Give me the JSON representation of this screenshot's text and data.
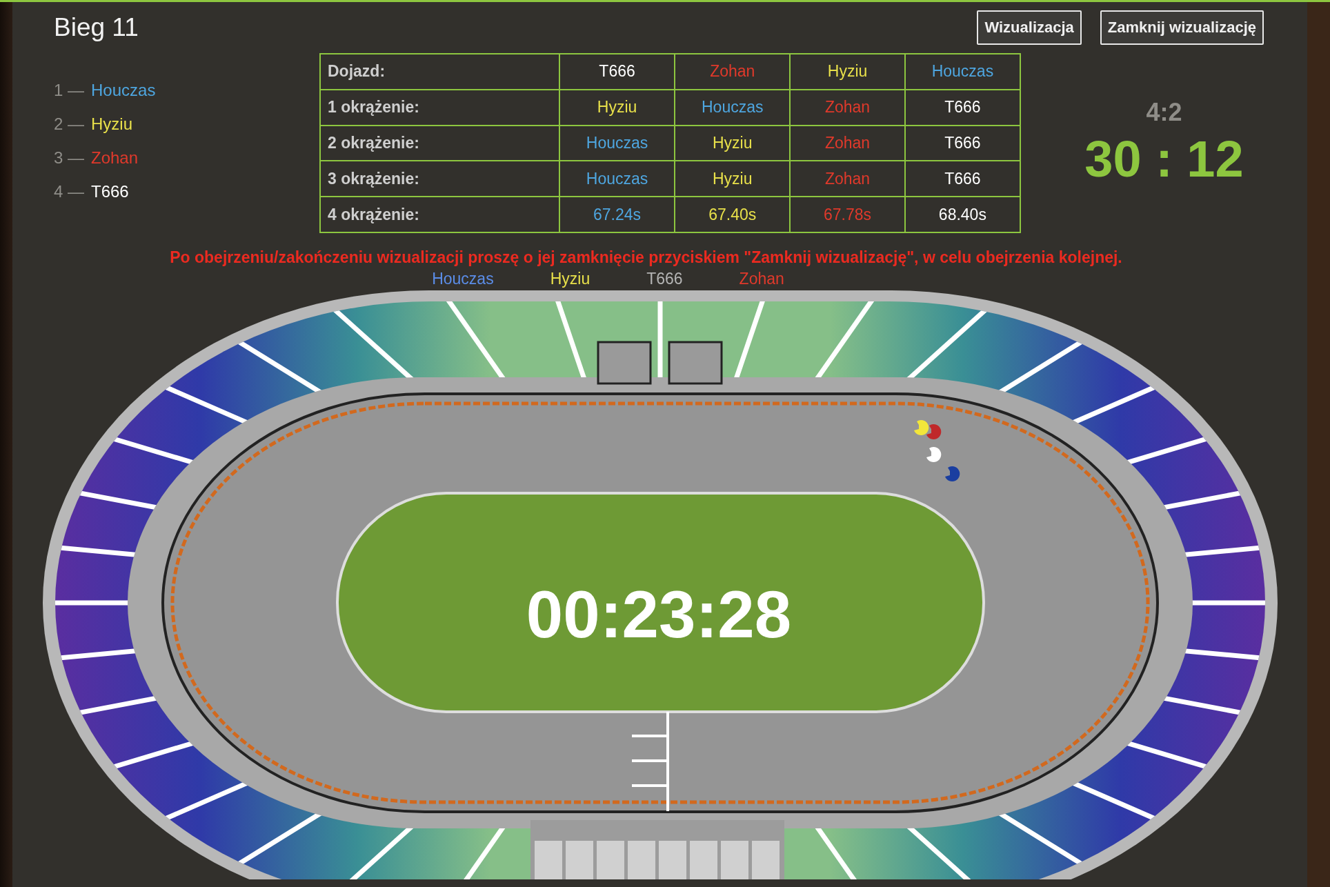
{
  "title": "Bieg 11",
  "buttons": [
    {
      "label": "Wizualizacja"
    },
    {
      "label": "Zamknij wizualizację"
    }
  ],
  "standings": [
    {
      "place": "1 —",
      "name": "Houczas",
      "color": "#4ea6e0"
    },
    {
      "place": "2 —",
      "name": "Hyziu",
      "color": "#e8e04a"
    },
    {
      "place": "3 —",
      "name": "Zohan",
      "color": "#e0392b"
    },
    {
      "place": "4 —",
      "name": "T666",
      "color": "#ffffff"
    }
  ],
  "table": {
    "rows": [
      {
        "label": "Dojazd:",
        "cells": [
          {
            "text": "T666",
            "color": "#ffffff"
          },
          {
            "text": "Zohan",
            "color": "#e0392b"
          },
          {
            "text": "Hyziu",
            "color": "#e8e04a"
          },
          {
            "text": "Houczas",
            "color": "#4ea6e0"
          }
        ]
      },
      {
        "label": "1 okrążenie:",
        "cells": [
          {
            "text": "Hyziu",
            "color": "#e8e04a"
          },
          {
            "text": "Houczas",
            "color": "#4ea6e0"
          },
          {
            "text": "Zohan",
            "color": "#e0392b"
          },
          {
            "text": "T666",
            "color": "#ffffff"
          }
        ]
      },
      {
        "label": "2 okrążenie:",
        "cells": [
          {
            "text": "Houczas",
            "color": "#4ea6e0"
          },
          {
            "text": "Hyziu",
            "color": "#e8e04a"
          },
          {
            "text": "Zohan",
            "color": "#e0392b"
          },
          {
            "text": "T666",
            "color": "#ffffff"
          }
        ]
      },
      {
        "label": "3 okrążenie:",
        "cells": [
          {
            "text": "Houczas",
            "color": "#4ea6e0"
          },
          {
            "text": "Hyziu",
            "color": "#e8e04a"
          },
          {
            "text": "Zohan",
            "color": "#e0392b"
          },
          {
            "text": "T666",
            "color": "#ffffff"
          }
        ]
      },
      {
        "label": "4 okrążenie:",
        "cells": [
          {
            "text": "67.24s",
            "color": "#4ea6e0"
          },
          {
            "text": "67.40s",
            "color": "#e8e04a"
          },
          {
            "text": "67.78s",
            "color": "#e0392b"
          },
          {
            "text": "68.40s",
            "color": "#ffffff"
          }
        ]
      }
    ]
  },
  "score": {
    "heat": "4:2",
    "total": "30 : 12"
  },
  "notice": "Po obejrzeniu/zakończeniu wizualizacji proszę o jej zamknięcie przyciskiem \"Zamknij wizualizację\", w celu obejrzenia kolejnej.",
  "legend": [
    {
      "name": "Houczas",
      "color": "#5b8de8"
    },
    {
      "name": "Hyziu",
      "color": "#e8e04a"
    },
    {
      "name": "T666",
      "color": "#b4b4b4"
    },
    {
      "name": "Zohan",
      "color": "#e0392b"
    }
  ],
  "track": {
    "timer": "00:23:28",
    "helmets": [
      {
        "color": "#f2e63a"
      },
      {
        "color": "#c0282a"
      },
      {
        "color": "#ffffff"
      },
      {
        "color": "#1a3ea0"
      }
    ]
  }
}
